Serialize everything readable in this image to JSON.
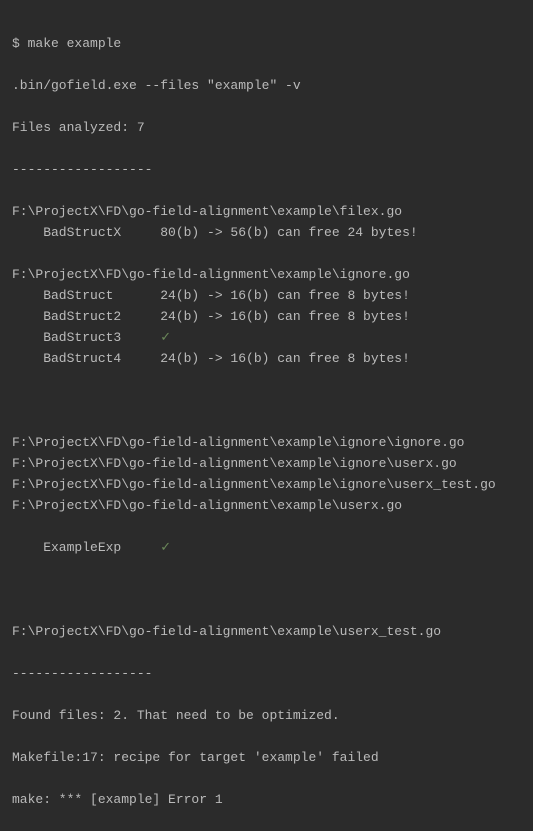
{
  "terminal": {
    "prompt": "$ ",
    "command": "make example",
    "exec_line": ".bin/gofield.exe --files \"example\" -v",
    "analyzed_line": "Files analyzed: 7",
    "divider": "------------------",
    "sections": [
      {
        "path": "F:\\ProjectX\\FD\\go-field-alignment\\example\\filex.go",
        "rows": [
          {
            "name": "BadStructX",
            "before": "80(b)",
            "after": "56(b)",
            "savings": "24",
            "ok": false
          }
        ]
      },
      {
        "path": "F:\\ProjectX\\FD\\go-field-alignment\\example\\ignore.go",
        "rows": [
          {
            "name": "BadStruct",
            "before": "24(b)",
            "after": "16(b)",
            "savings": "8",
            "ok": false
          },
          {
            "name": "BadStruct2",
            "before": "24(b)",
            "after": "16(b)",
            "savings": "8",
            "ok": false
          },
          {
            "name": "BadStruct3",
            "ok": true
          },
          {
            "name": "BadStruct4",
            "before": "24(b)",
            "after": "16(b)",
            "savings": "8",
            "ok": false
          }
        ]
      }
    ],
    "extra_paths": [
      "F:\\ProjectX\\FD\\go-field-alignment\\example\\ignore\\ignore.go",
      "F:\\ProjectX\\FD\\go-field-alignment\\example\\ignore\\userx.go",
      "F:\\ProjectX\\FD\\go-field-alignment\\example\\ignore\\userx_test.go",
      "F:\\ProjectX\\FD\\go-field-alignment\\example\\userx.go"
    ],
    "userx_row": {
      "name": "ExampleExp",
      "ok": true
    },
    "last_path": "F:\\ProjectX\\FD\\go-field-alignment\\example\\userx_test.go",
    "found_line": "Found files: 2. That need to be optimized.",
    "makefile_line": "Makefile:17: recipe for target 'example' failed",
    "make_error_line": "make: *** [example] Error 1",
    "checkmark": "✓"
  }
}
